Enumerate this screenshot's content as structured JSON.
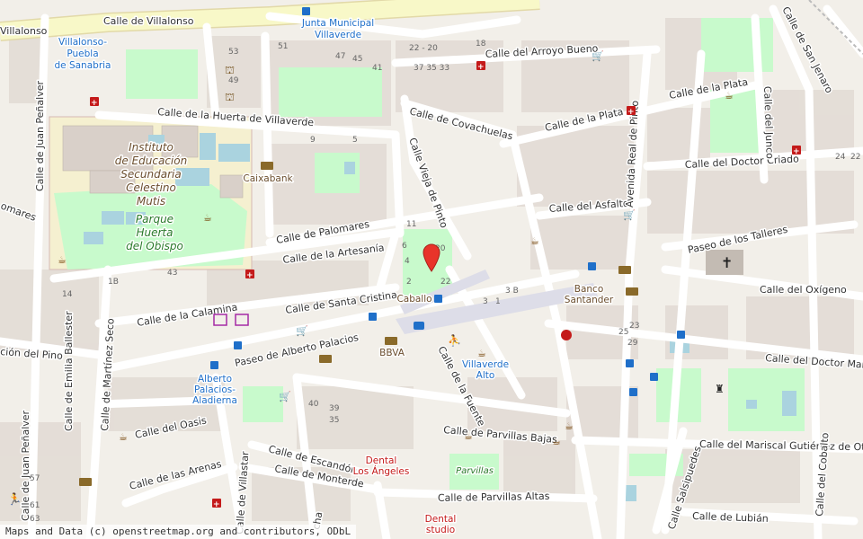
{
  "streets": {
    "villalonso": "Calle de Villalonso",
    "villalonso_left": "Villalonso",
    "arroyo_bueno": "Calle del Arroyo Bueno",
    "covachuelas": "Calle de Covachuelas",
    "plata1": "Calle de la Plata",
    "plata2": "Calle de la Plata",
    "huerta_villaverde": "Calle de la Huerta de Villaverde",
    "juan_penalver": "Calle de Juan Peñalver",
    "juan_penalver2": "Calle de Juan Peñalver",
    "palomares": "Calle de Palomares",
    "palomares_left": "Palomares",
    "artesania": "Calle de la Artesanía",
    "vieja_pinto": "Calle Vieja de Pinto",
    "santa_cristina": "Calle de Santa Cristina",
    "calamina": "Calle de la Calamina",
    "alberto_palacios": "Paseo de Alberto Palacios",
    "asfalto": "Calle del Asfalto",
    "doctor_criado": "Calle del Doctor Criado",
    "avenida_real_pinto": "Avenida Real de Pinto",
    "junco": "Calle del Junco",
    "san_jenaro": "Calle de San Jenaro",
    "talleres": "Paseo de los Talleres",
    "oxigeno": "Calle del Oxígeno",
    "doctor_martin": "Calle del Doctor Martí",
    "pino": "ción del Pino",
    "emilia_ballester": "Calle de Emilia Ballester",
    "martinez_seco": "Calle de Martínez Seco",
    "fuente": "Calle de la Fuente",
    "oasis": "Calle del Oasis",
    "parvillas_bajas": "Calle de Parvillas Bajas",
    "mariscal": "Calle del Mariscal Gutiérrez de Otero",
    "escandon": "Calle de Escandón",
    "arenas": "Calle de las Arenas",
    "monterde": "Calle de Monterde",
    "villastar": "Calle de Villastar",
    "parvillas_altas": "Calle de Parvillas Altas",
    "salsipuedes": "Calle Salsipuedes",
    "cobalto": "Calle del Cobalto",
    "lubian": "Calle de Lubián",
    "tomares": "omares",
    "cha": "cha"
  },
  "pois": {
    "junta": [
      "Junta Municipal",
      "Villaverde"
    ],
    "villalonso_puebla": [
      "Villalonso-",
      "Puebla",
      "de Sanabria"
    ],
    "instituto": [
      "Instituto",
      "de Educación",
      "Secundaria",
      "Celestino",
      "Mutis"
    ],
    "parque": [
      "Parque",
      "Huerta",
      "del Obispo"
    ],
    "caixabank": "Caixabank",
    "caballo": "Caballo",
    "banco_santander": [
      "Banco",
      "Santander"
    ],
    "bbva": "BBVA",
    "villaverde_alto": [
      "Villaverde",
      "Alto"
    ],
    "alberto_palacios_station": [
      "Alberto",
      "Palacios-",
      "Aladierna"
    ],
    "dental_angeles": [
      "Dental",
      "Los Ángeles"
    ],
    "parvillas": "Parvillas",
    "dental_studio": [
      "Dental",
      "studio"
    ]
  },
  "house_numbers": {
    "n53": "53",
    "n49": "49",
    "n51": "51",
    "n47": "47",
    "n45": "45",
    "n43": "43",
    "n41": "41",
    "n22_20": "22 - 20",
    "n18": "18",
    "n37_35_33": "37 35 33",
    "n9": "9",
    "n5": "5",
    "n11": "11",
    "n4": "4",
    "n6": "6",
    "n20": "20",
    "n22": "22",
    "n2": "2",
    "n3b": "3 B",
    "n24": "24",
    "n22b": "22",
    "n57": "57",
    "n61": "61",
    "n63": "63",
    "n40": "40",
    "n39": "39",
    "n35": "35",
    "n1b": "1B",
    "n14": "14",
    "n23": "23",
    "n29": "29",
    "n25": "25",
    "n3": "3",
    "n1": "1"
  },
  "attribution": "Maps and Data (c) openstreetmap.org and contributors, ODbL",
  "colors": {
    "background": "#f2efe9",
    "road": "#ffffff",
    "primary_road": "#f8f8c8",
    "park": "#c8facc",
    "building": "#d9d0c9",
    "school": "#f5f0d0",
    "marker": "#e8342a",
    "water": "#aad3df"
  }
}
